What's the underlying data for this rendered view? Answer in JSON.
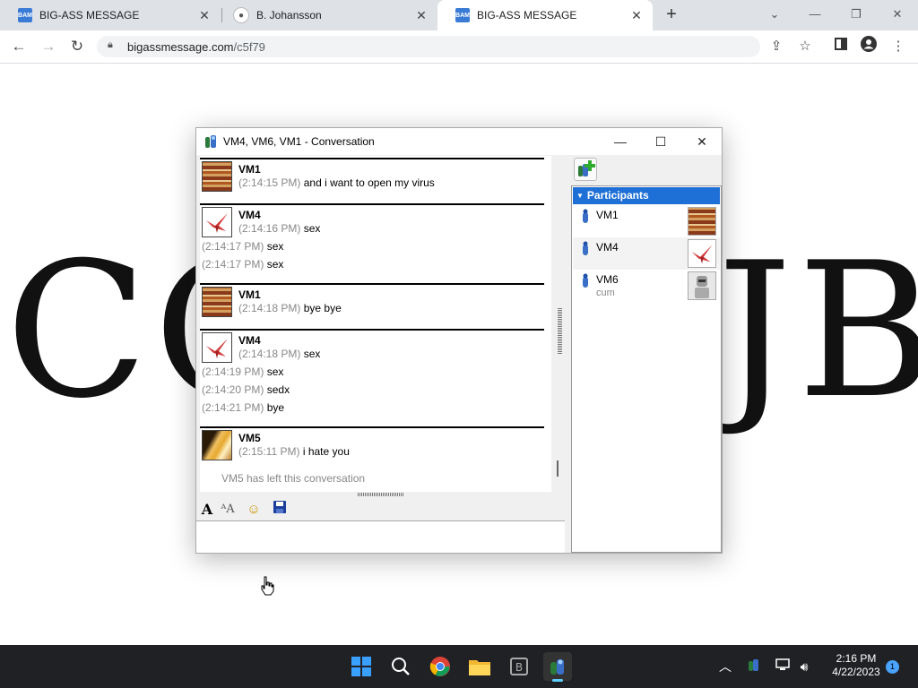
{
  "browser": {
    "tabs": [
      {
        "title": "BIG-ASS MESSAGE",
        "favicon": "BAM",
        "active": false
      },
      {
        "title": "B. Johansson",
        "favicon": "circle",
        "active": false
      },
      {
        "title": "BIG-ASS MESSAGE",
        "favicon": "BAM",
        "active": true
      }
    ],
    "url_host": "bigassmessage.com",
    "url_path": "/c5f79"
  },
  "page": {
    "big_text_left": "CO",
    "big_text_right": "JB"
  },
  "conversation": {
    "title": "VM4, VM6, VM1 - Conversation",
    "messages": [
      {
        "sender": "VM1",
        "avatar": "books",
        "lines": [
          {
            "time": "(2:14:15 PM)",
            "text": "and i want to open my virus"
          }
        ]
      },
      {
        "sender": "VM4",
        "avatar": "crane",
        "lines": [
          {
            "time": "(2:14:16 PM)",
            "text": "sex"
          },
          {
            "time": "(2:14:17 PM)",
            "text": "sex"
          },
          {
            "time": "(2:14:17 PM)",
            "text": "sex"
          }
        ]
      },
      {
        "sender": "VM1",
        "avatar": "books",
        "lines": [
          {
            "time": "(2:14:18 PM)",
            "text": "bye bye"
          }
        ]
      },
      {
        "sender": "VM4",
        "avatar": "crane",
        "lines": [
          {
            "time": "(2:14:18 PM)",
            "text": "sex"
          },
          {
            "time": "(2:14:19 PM)",
            "text": "sex"
          },
          {
            "time": "(2:14:20 PM)",
            "text": "sedx"
          },
          {
            "time": "(2:14:21 PM)",
            "text": "bye"
          }
        ]
      },
      {
        "sender": "VM5",
        "avatar": "gold",
        "lines": [
          {
            "time": "(2:15:11 PM)",
            "text": "i hate you"
          }
        ]
      }
    ],
    "system_notice": "VM5 has left this conversation",
    "participants_header": "Participants",
    "participants": [
      {
        "name": "VM1",
        "status": "",
        "avatar": "books"
      },
      {
        "name": "VM4",
        "status": "",
        "avatar": "crane"
      },
      {
        "name": "VM6",
        "status": "cum",
        "avatar": "robot"
      }
    ]
  },
  "taskbar": {
    "time": "2:16 PM",
    "date": "4/22/2023",
    "notification_count": "1"
  }
}
